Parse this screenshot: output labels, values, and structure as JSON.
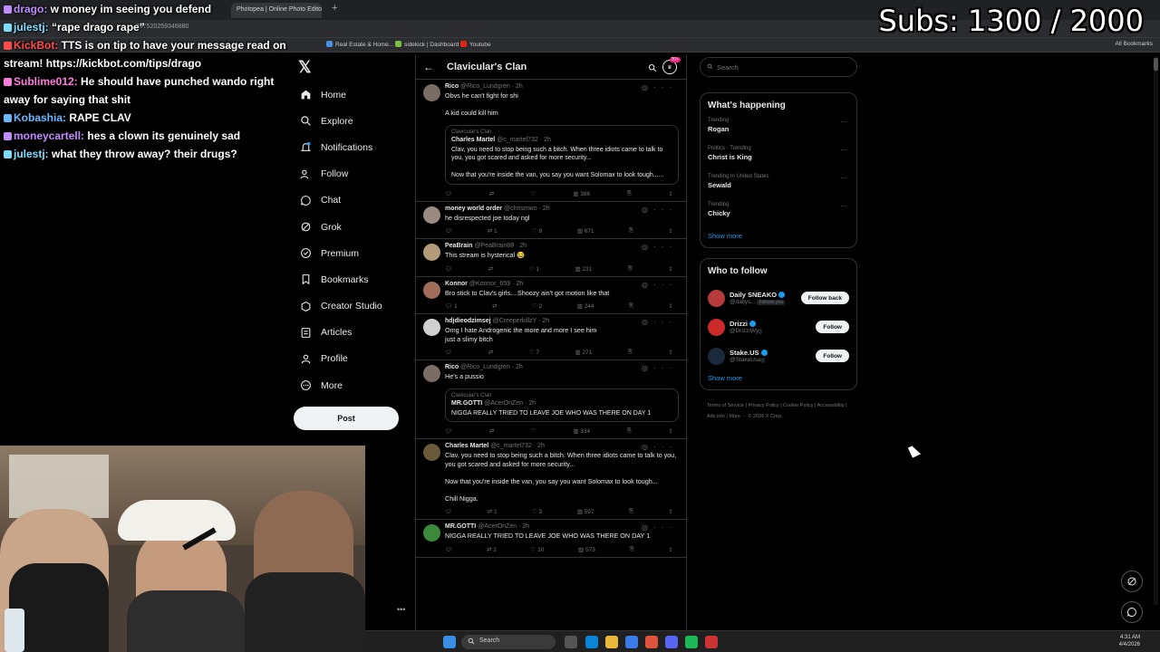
{
  "overlay": {
    "subs": "Subs: 1300 / 2000"
  },
  "chat": [
    {
      "user": "drago:",
      "text": " w money im seeing you defend",
      "color": "#c08cff"
    },
    {
      "user": "julestj:",
      "text": " “rape drago rape”",
      "color": "#7fdcff"
    },
    {
      "user": "KickBot:",
      "text": " TTS is on tip to have your message read on stream! https://kickbot.com/tips/drago",
      "color": "#ff4b4b"
    },
    {
      "user": "Sublime012:",
      "text": " He should have punched wando right away for saying that shit",
      "color": "#ff7bdc"
    },
    {
      "user": "Kobashia:",
      "text": " RAPE CLAV",
      "color": "#6cb6ff"
    },
    {
      "user": "moneycartell:",
      "text": " hes a clown its genuinely sad",
      "color": "#c08cff"
    },
    {
      "user": "julestj:",
      "text": " what they throw away? their drugs?",
      "color": "#7fdcff"
    }
  ],
  "browser": {
    "tab_title": "Photopea | Online Photo Editor",
    "url": "797520259346880",
    "bookmarks": [
      "Real Estate & Home...",
      "sidekick | Dashboard",
      "Youtube"
    ],
    "all_bookmarks": "All Bookmarks"
  },
  "nav": {
    "items": [
      {
        "label": "Home",
        "icon": "home-icon"
      },
      {
        "label": "Explore",
        "icon": "search-icon"
      },
      {
        "label": "Notifications",
        "icon": "bell-icon"
      },
      {
        "label": "Follow",
        "icon": "follow-icon"
      },
      {
        "label": "Chat",
        "icon": "chat-icon"
      },
      {
        "label": "Grok",
        "icon": "grok-icon"
      },
      {
        "label": "Premium",
        "icon": "premium-icon"
      },
      {
        "label": "Bookmarks",
        "icon": "bookmark-icon"
      },
      {
        "label": "Creator Studio",
        "icon": "creator-icon"
      },
      {
        "label": "Articles",
        "icon": "articles-icon"
      },
      {
        "label": "Profile",
        "icon": "profile-icon"
      },
      {
        "label": "More",
        "icon": "more-icon"
      }
    ],
    "post_label": "Post"
  },
  "timeline": {
    "title": "Clavicular's Clan",
    "badge": "20+",
    "tweets": [
      {
        "name": "Rico",
        "handle": "@Rico_Lundgren · 2h",
        "body": "Obvs he can't fight for shi\n\nA kid could kill him",
        "avatar": "#7a6d66",
        "quote": {
          "ctx": "Clavicular's Clan",
          "name": "Charles Martel",
          "handle": "@c_martel732 · 2h",
          "body": "Clav, you need to stop being such a bitch. When three idiots came to talk to you, you got scared and asked for more security...\n\nNow that you're inside the van, you say you want Solomax to look tough......"
        },
        "replies": "",
        "retweets": "",
        "likes": "",
        "views": "386"
      },
      {
        "name": "money world order",
        "handle": "@chrismwo · 2h",
        "body": "he disrespected joe today ngl",
        "avatar": "#9a8a80",
        "replies": "",
        "retweets": "1",
        "likes": "9",
        "views": "671"
      },
      {
        "name": "PeaBrain",
        "handle": "@PeaBrain88 · 2h",
        "body": "This stream is hysterical 😂",
        "avatar": "#b39b7a",
        "replies": "",
        "retweets": "",
        "likes": "1",
        "views": "231"
      },
      {
        "name": "Konnor",
        "handle": "@Konnor_659 · 2h",
        "body": "Bro stick to Clav's girls....Shoozy ain't got motion like that",
        "avatar": "#a06d5a",
        "replies": "1",
        "retweets": "",
        "likes": "2",
        "views": "244"
      },
      {
        "name": "hdjdieodzimsej",
        "handle": "@CreeperkillzY · 2h",
        "body": "Omg I hate Androgenic the more and more I see him\njust a slimy bitch",
        "avatar": "#d0d0d0",
        "replies": "",
        "retweets": "",
        "likes": "7",
        "views": "271"
      },
      {
        "name": "Rico",
        "handle": "@Rico_Lundgren · 2h",
        "body": "He's a pussio",
        "avatar": "#7a6d66",
        "quote": {
          "ctx": "Clavicular's Clan",
          "name": "MR.GOTTI",
          "handle": "@AcerOnZen · 2h",
          "body": "NIGGA REALLY TRIED TO LEAVE JOE WHO WAS THERE ON DAY 1"
        },
        "replies": "",
        "retweets": "",
        "likes": "",
        "views": "334"
      },
      {
        "name": "Charles Martel",
        "handle": "@c_martel732 · 2h",
        "body": "Clav, you need to stop being such a bitch. When three idiots came to talk to you, you got scared and asked for more security...\n\nNow that you're inside the van, you say you want Solomax to look tough...\n\nChill Nigga.",
        "avatar": "#6a5a3a",
        "replies": "",
        "retweets": "1",
        "likes": "3",
        "views": "597"
      },
      {
        "name": "MR.GOTTI",
        "handle": "@AcerOnZen · 2h",
        "body": "NIGGA REALLY TRIED TO LEAVE JOE WHO WAS THERE ON DAY 1",
        "avatar": "#3a8a3a",
        "replies": "",
        "retweets": "2",
        "likes": "10",
        "views": "573"
      }
    ]
  },
  "right": {
    "search_placeholder": "Search",
    "happening": {
      "title": "What's happening",
      "trends": [
        {
          "ctx": "Trending",
          "topic": "Rogan"
        },
        {
          "ctx": "Politics · Trending",
          "topic": "Christ is King"
        },
        {
          "ctx": "Trending in United States",
          "topic": "Sewald"
        },
        {
          "ctx": "Trending",
          "topic": "Chicky"
        }
      ],
      "show_more": "Show more"
    },
    "who_to_follow": {
      "title": "Who to follow",
      "users": [
        {
          "name": "Daily SNEAKO",
          "handle": "@dailys...",
          "extra": "Follows you",
          "button": "Follow back",
          "avatar": "#b83a3a"
        },
        {
          "name": "Drizzi",
          "handle": "@DrizziWy",
          "extra": "",
          "button": "Follow",
          "avatar": "#cc2a2a"
        },
        {
          "name": "Stake.US",
          "handle": "@StakeUsa",
          "extra": "",
          "button": "Follow",
          "avatar": "#1b2a3a"
        }
      ],
      "show_more": "Show more"
    },
    "footer": "Terms of Service  |  Privacy Policy  |  Cookie Policy  |  Accessibility  |  Ads info  |  More ···  © 2026 X Corp."
  },
  "taskbar": {
    "search": "Search",
    "time": "4:31 AM",
    "date": "4/4/2026"
  }
}
